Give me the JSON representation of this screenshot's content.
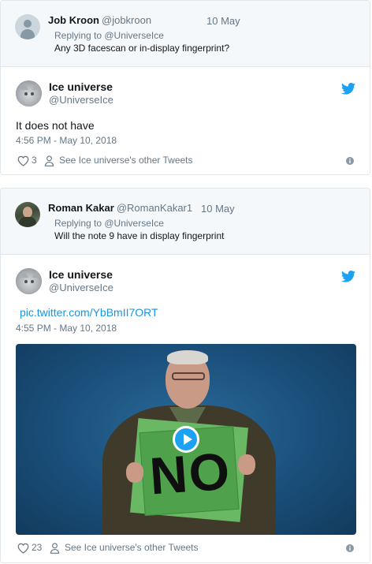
{
  "reply1": {
    "name": "Job Kroon",
    "handle": "@jobkroon",
    "date": "10 May",
    "replying_to": "Replying to @UniverseIce",
    "text": "Any 3D facescan or in-display fingerprint?"
  },
  "tweet1": {
    "name": "Ice universe",
    "handle": "@UniverseIce",
    "text": "It does not have",
    "timestamp": "4:56 PM - May 10, 2018",
    "likes": "3",
    "other_tweets": "See Ice universe's other Tweets"
  },
  "reply2": {
    "name": "Roman Kakar",
    "handle": "@RomanKakar1",
    "date": "10 May",
    "replying_to": "Replying to @UniverseIce",
    "text": "Will the note 9 have in display fingerprint"
  },
  "tweet2": {
    "name": "Ice universe",
    "handle": "@UniverseIce",
    "link": "pic.twitter.com/YbBmII7ORT",
    "timestamp": "4:55 PM - May 10, 2018",
    "media_text": "NO",
    "likes": "23",
    "other_tweets": "See Ice universe's other Tweets"
  },
  "colors": {
    "twitter_blue": "#1da1f2",
    "link_blue": "#1b95e0",
    "muted": "#657786",
    "reply_bg": "#f5f8fa"
  },
  "icons": [
    "default-avatar-icon",
    "twitter-bird-icon",
    "heart-icon",
    "person-icon",
    "info-icon",
    "play-icon"
  ]
}
